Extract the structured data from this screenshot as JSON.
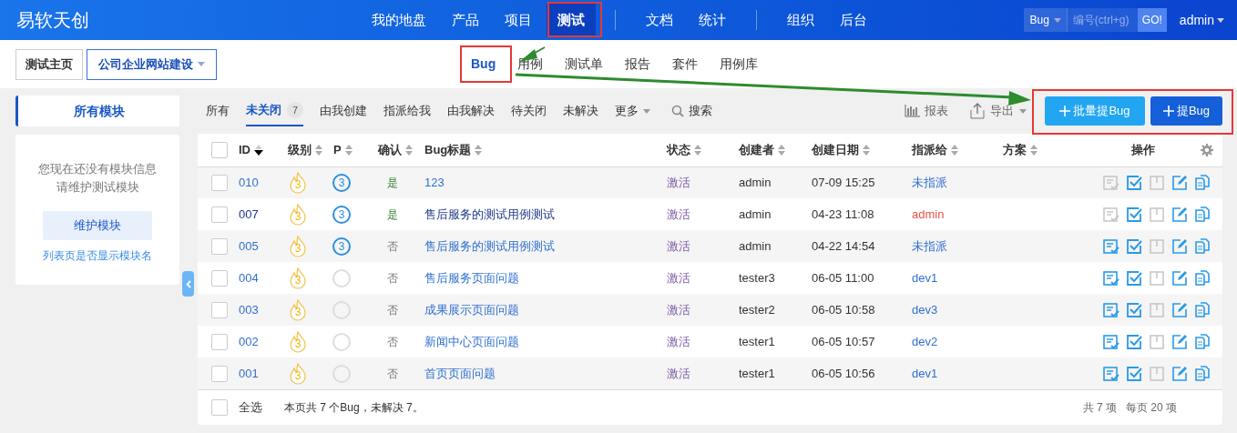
{
  "header": {
    "logo": "易软天创",
    "nav": [
      {
        "kind": "item",
        "label": "我的地盘",
        "selected": false
      },
      {
        "kind": "item",
        "label": "产品",
        "selected": false
      },
      {
        "kind": "item",
        "label": "项目",
        "selected": false
      },
      {
        "kind": "item",
        "label": "测试",
        "selected": true
      },
      {
        "kind": "divider"
      },
      {
        "kind": "item",
        "label": "文档",
        "selected": false
      },
      {
        "kind": "item",
        "label": "统计",
        "selected": false
      },
      {
        "kind": "divider"
      },
      {
        "kind": "item",
        "label": "组织",
        "selected": false
      },
      {
        "kind": "item",
        "label": "后台",
        "selected": false
      }
    ],
    "search": {
      "type": "Bug",
      "placeholder": "编号(ctrl+g)",
      "button": "GO!"
    },
    "user": "admin"
  },
  "subnav": {
    "breadcrumb": [
      {
        "label": "测试主页",
        "dropdown": false
      },
      {
        "label": "公司企业网站建设",
        "dropdown": true
      }
    ],
    "tabs": [
      {
        "label": "Bug",
        "selected": true
      },
      {
        "label": "用例",
        "selected": false
      },
      {
        "label": "测试单",
        "selected": false
      },
      {
        "label": "报告",
        "selected": false
      },
      {
        "label": "套件",
        "selected": false
      },
      {
        "label": "用例库",
        "selected": false
      }
    ]
  },
  "sidebar": {
    "title": "所有模块",
    "message": [
      "您现在还没有模块信息",
      "请维护测试模块"
    ],
    "button": "维护模块",
    "link": "列表页是否显示模块名"
  },
  "filters": [
    {
      "label": "所有",
      "selected": false
    },
    {
      "label": "未关闭",
      "selected": true,
      "count": "7"
    },
    {
      "label": "由我创建",
      "selected": false
    },
    {
      "label": "指派给我",
      "selected": false
    },
    {
      "label": "由我解决",
      "selected": false
    },
    {
      "label": "待关闭",
      "selected": false
    },
    {
      "label": "未解决",
      "selected": false
    },
    {
      "label": "更多",
      "selected": false,
      "dropdown": true
    }
  ],
  "search_label": "搜索",
  "report_label": "报表",
  "export_label": "导出",
  "actions": [
    {
      "label": "批量提Bug",
      "kind": "secondary"
    },
    {
      "label": "提Bug",
      "kind": "primary"
    }
  ],
  "table": {
    "all_checked": false,
    "columns": [
      {
        "label": "ID",
        "sortable": true,
        "sort_desc": true
      },
      {
        "label": "级别",
        "sortable": true,
        "sort_desc": false
      },
      {
        "label": "P",
        "sortable": true,
        "sort_desc": false
      },
      {
        "label": "确认",
        "sortable": true,
        "sort_desc": false
      },
      {
        "label": "Bug标题",
        "sortable": true,
        "sort_desc": false
      },
      {
        "label": "状态",
        "sortable": true,
        "sort_desc": false
      },
      {
        "label": "创建者",
        "sortable": true,
        "sort_desc": false
      },
      {
        "label": "创建日期",
        "sortable": true,
        "sort_desc": false
      },
      {
        "label": "指派给",
        "sortable": true,
        "sort_desc": false
      },
      {
        "label": "方案",
        "sortable": true,
        "sort_desc": false
      },
      {
        "label": "操作"
      }
    ],
    "rows": [
      {
        "checked": false,
        "id": "010",
        "severity": "3",
        "priority": "3",
        "confirmed": true,
        "confirmed_label": "是",
        "title": "123",
        "visited": false,
        "status": "激活",
        "creator": "admin",
        "date": "07-09 15:25",
        "assigned": "未指派",
        "assigned_to_me": false,
        "confirm_enabled": false
      },
      {
        "checked": false,
        "id": "007",
        "severity": "3",
        "priority": "3",
        "confirmed": true,
        "confirmed_label": "是",
        "title": "售后服务的测试用例测试",
        "visited": true,
        "status": "激活",
        "creator": "admin",
        "date": "04-23 11:08",
        "assigned": "admin",
        "assigned_to_me": true,
        "confirm_enabled": false
      },
      {
        "checked": false,
        "id": "005",
        "severity": "3",
        "priority": "3",
        "confirmed": false,
        "confirmed_label": "否",
        "title": "售后服务的测试用例测试",
        "visited": false,
        "status": "激活",
        "creator": "admin",
        "date": "04-22 14:54",
        "assigned": "未指派",
        "assigned_to_me": false,
        "confirm_enabled": true
      },
      {
        "checked": false,
        "id": "004",
        "severity": "3",
        "confirmed": false,
        "confirmed_label": "否",
        "title": "售后服务页面问题",
        "visited": false,
        "status": "激活",
        "creator": "tester3",
        "date": "06-05 11:00",
        "assigned": "dev1",
        "assigned_to_me": false,
        "confirm_enabled": true
      },
      {
        "checked": false,
        "id": "003",
        "severity": "3",
        "confirmed": false,
        "confirmed_label": "否",
        "title": "成果展示页面问题",
        "visited": false,
        "status": "激活",
        "creator": "tester2",
        "date": "06-05 10:58",
        "assigned": "dev3",
        "assigned_to_me": false,
        "confirm_enabled": true
      },
      {
        "checked": false,
        "id": "002",
        "severity": "3",
        "confirmed": false,
        "confirmed_label": "否",
        "title": "新闻中心页面问题",
        "visited": false,
        "status": "激活",
        "creator": "tester1",
        "date": "06-05 10:57",
        "assigned": "dev2",
        "assigned_to_me": false,
        "confirm_enabled": true
      },
      {
        "checked": false,
        "id": "001",
        "severity": "3",
        "confirmed": false,
        "confirmed_label": "否",
        "title": "首页页面问题",
        "visited": false,
        "status": "激活",
        "creator": "tester1",
        "date": "06-05 10:56",
        "assigned": "dev1",
        "assigned_to_me": false,
        "confirm_enabled": true
      }
    ],
    "footer": {
      "checked": false,
      "select_all": "全选",
      "summary": "本页共 7 个Bug，未解决 7。",
      "total": "共 7 项",
      "per_page": "每页 20 项"
    }
  }
}
